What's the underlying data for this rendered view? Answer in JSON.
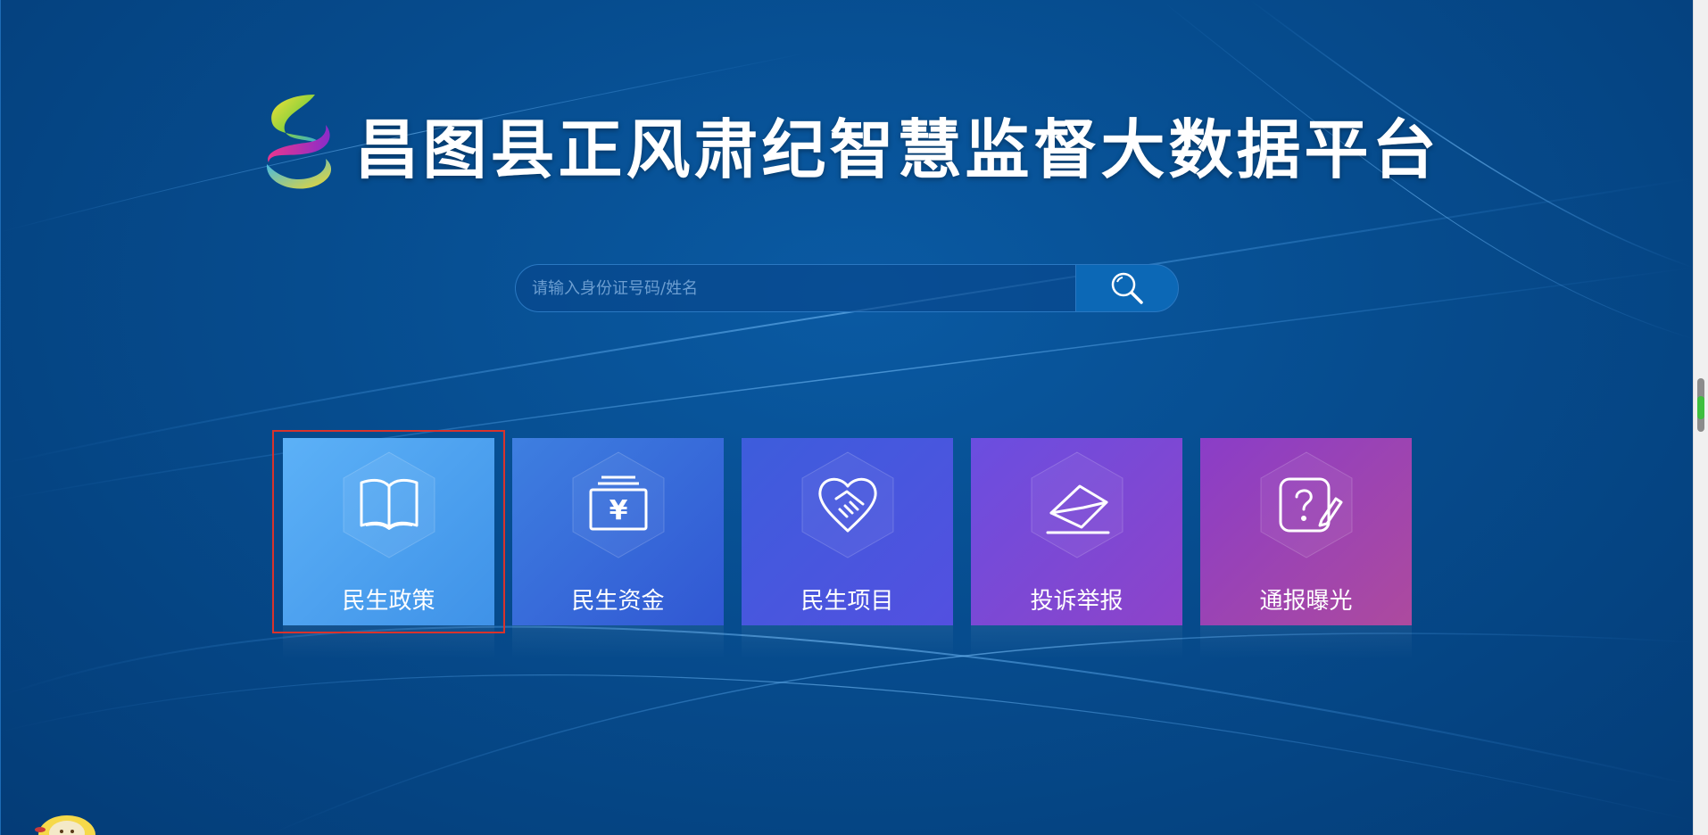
{
  "header": {
    "title": "昌图县正风肃纪智慧监督大数据平台",
    "logo_icon": "s-swirl-logo-icon"
  },
  "search": {
    "placeholder": "请输入身份证号码/姓名",
    "value": "",
    "button_icon": "search-icon"
  },
  "tiles": [
    {
      "label": "民生政策",
      "icon": "book-icon",
      "selected": true
    },
    {
      "label": "民生资金",
      "icon": "money-yuan-icon",
      "selected": false
    },
    {
      "label": "民生项目",
      "icon": "handshake-icon",
      "selected": false
    },
    {
      "label": "投诉举报",
      "icon": "envelope-report-icon",
      "selected": false
    },
    {
      "label": "通报曝光",
      "icon": "question-pen-icon",
      "selected": false
    }
  ],
  "colors": {
    "background": "#064c8e",
    "highlight": "#d9332c",
    "tile_1": "#5cb1f7",
    "tile_2": "#3e7fe0",
    "tile_3": "#4d55de",
    "tile_4": "#7a48d6",
    "tile_5": "#a0449f"
  }
}
